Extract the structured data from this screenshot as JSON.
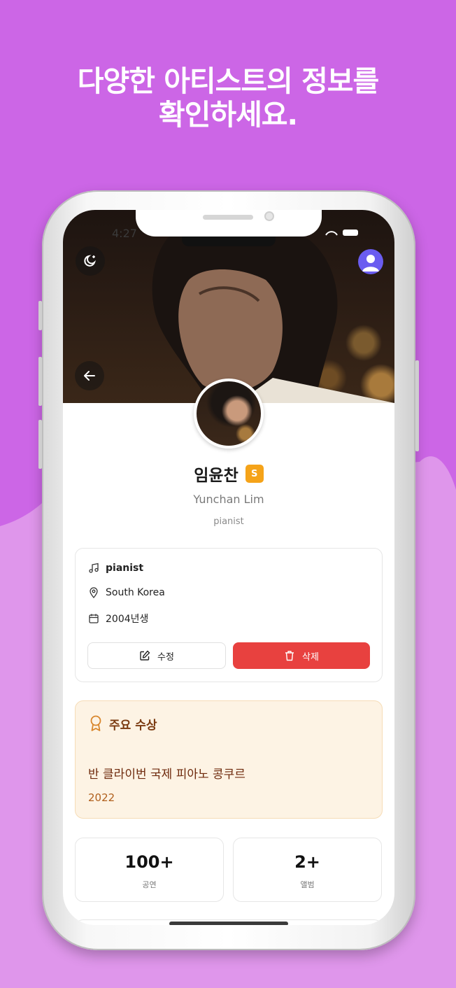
{
  "headline": {
    "line1": "다양한 아티스트의 정보를",
    "line2": "확인하세요."
  },
  "status_bar": {
    "time": "4:27"
  },
  "colors": {
    "background": "#cc66e6",
    "background_lower": "#df96eb",
    "accent_award_bg": "#fdf3e4",
    "delete": "#e8413f",
    "badge": "#f5a319"
  },
  "artist": {
    "name": "임윤찬",
    "badge": "S",
    "english_name": "Yunchan Lim",
    "subtitle": "pianist"
  },
  "info": {
    "items": [
      {
        "icon": "music-note-icon",
        "text": "pianist"
      },
      {
        "icon": "map-pin-icon",
        "text": "South Korea"
      },
      {
        "icon": "calendar-icon",
        "text": "2004년생"
      }
    ],
    "edit_label": "수정",
    "delete_label": "삭제"
  },
  "award": {
    "title": "주요 수상",
    "name": "반 클라이번 국제 피아노 콩쿠르",
    "year": "2022"
  },
  "stats": [
    {
      "value": "100+",
      "label": "공연"
    },
    {
      "value": "2+",
      "label": "앨범"
    }
  ]
}
